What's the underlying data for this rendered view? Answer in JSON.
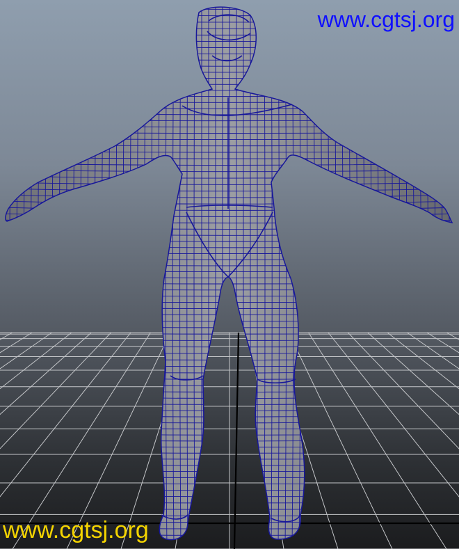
{
  "viewport": {
    "background_top": "#8f9eae",
    "background_bottom": "#1b1c1e",
    "grid_color": "#c4c6c9",
    "axis_color": "#000000",
    "mesh_fill": "#8a8c91",
    "wire_color": "#18189a"
  },
  "watermarks": {
    "top_text": "www.cgtsj.org",
    "top_color": "#1010ff",
    "bottom_text": "www.cgtsj.org",
    "bottom_color": "#f4d400"
  }
}
